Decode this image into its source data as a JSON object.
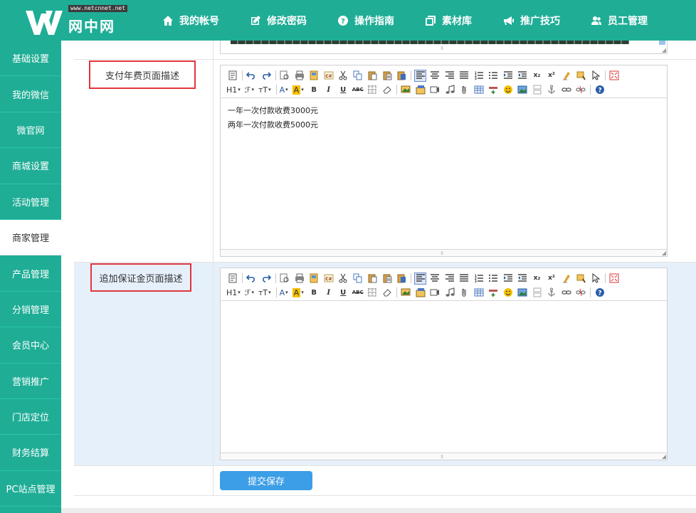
{
  "brand": {
    "site_tag": "www.netcnnet.net",
    "name": "网中网",
    "color": "#1fad96"
  },
  "topnav": [
    {
      "label": "我的帐号",
      "icon": "home-icon"
    },
    {
      "label": "修改密码",
      "icon": "edit-icon"
    },
    {
      "label": "操作指南",
      "icon": "question-icon"
    },
    {
      "label": "素材库",
      "icon": "gallery-icon"
    },
    {
      "label": "推广技巧",
      "icon": "megaphone-icon"
    },
    {
      "label": "员工管理",
      "icon": "users-icon"
    }
  ],
  "sidebar": {
    "active": "商家管理",
    "items": [
      "基础设置",
      "我的微信",
      "微官网",
      "商城设置",
      "活动管理",
      "商家管理",
      "产品管理",
      "分销管理",
      "会员中心",
      "营销推广",
      "门店定位",
      "财务结算",
      "PC站点管理"
    ]
  },
  "form": {
    "fields": [
      {
        "label": "支付年费页面描述",
        "content": [
          "一年一次付款收费3000元",
          "两年一次付款收费5000元"
        ]
      },
      {
        "label": "追加保证金页面描述",
        "content": []
      }
    ],
    "submit_label": "提交保存"
  },
  "editor_toolbar": {
    "heading_label": "H1",
    "font_label": "ℱ",
    "size_label": "тT",
    "font_color_label": "A",
    "bg_color_label": "A",
    "bold": "B",
    "italic": "I",
    "underline": "U",
    "strike": "ABC",
    "subscript": "x₂",
    "superscript": "x²",
    "accent_color": "#e2353c",
    "button_color": "#3c9ee7"
  }
}
